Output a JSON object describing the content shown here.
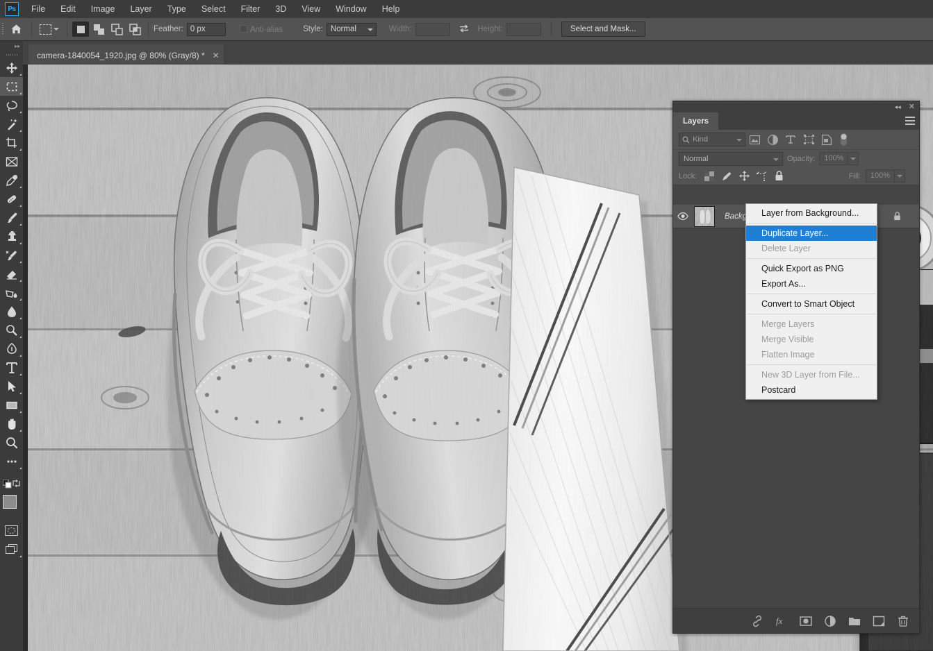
{
  "app": {
    "logo": "Ps",
    "accent": "#31a8ff",
    "menu_highlight": "#1e7fd4"
  },
  "menubar": {
    "items": [
      {
        "label": "File"
      },
      {
        "label": "Edit"
      },
      {
        "label": "Image"
      },
      {
        "label": "Layer"
      },
      {
        "label": "Type"
      },
      {
        "label": "Select"
      },
      {
        "label": "Filter"
      },
      {
        "label": "3D"
      },
      {
        "label": "View"
      },
      {
        "label": "Window"
      },
      {
        "label": "Help"
      }
    ]
  },
  "options_bar": {
    "home_icon": "home-icon",
    "tool_preview_icon": "rectangular-marquee-icon",
    "bool_modes": [
      {
        "name": "new-selection",
        "active": true
      },
      {
        "name": "add-to-selection",
        "active": false
      },
      {
        "name": "subtract-from-selection",
        "active": false
      },
      {
        "name": "intersect-with-selection",
        "active": false
      }
    ],
    "feather_label": "Feather:",
    "feather_value": "0 px",
    "antialias_label": "Anti-alias",
    "antialias_checked": false,
    "style_label": "Style:",
    "style_value": "Normal",
    "width_label": "Width:",
    "width_value": "",
    "swap_icon": "swap-width-height-icon",
    "height_label": "Height:",
    "height_value": "",
    "select_and_mask_label": "Select and Mask..."
  },
  "toolbar": {
    "collapse_icon": "expand-panel-icon",
    "tools": [
      {
        "name": "move-tool",
        "icon": "move-icon",
        "active": false,
        "has_flyout": true
      },
      {
        "name": "rectangular-marquee-tool",
        "icon": "marquee-icon",
        "active": true,
        "has_flyout": true
      },
      {
        "name": "lasso-tool",
        "icon": "lasso-icon",
        "active": false,
        "has_flyout": true
      },
      {
        "name": "object-selection-tool",
        "icon": "magic-wand-icon",
        "active": false,
        "has_flyout": true
      },
      {
        "name": "crop-tool",
        "icon": "crop-icon",
        "active": false,
        "has_flyout": true
      },
      {
        "name": "frame-tool",
        "icon": "frame-icon",
        "active": false,
        "has_flyout": false
      },
      {
        "name": "eyedropper-tool",
        "icon": "eyedropper-icon",
        "active": false,
        "has_flyout": true
      },
      {
        "name": "spot-healing-brush-tool",
        "icon": "healing-brush-icon",
        "active": false,
        "has_flyout": true
      },
      {
        "name": "brush-tool",
        "icon": "brush-icon",
        "active": false,
        "has_flyout": true
      },
      {
        "name": "clone-stamp-tool",
        "icon": "clone-stamp-icon",
        "active": false,
        "has_flyout": true
      },
      {
        "name": "history-brush-tool",
        "icon": "history-brush-icon",
        "active": false,
        "has_flyout": true
      },
      {
        "name": "eraser-tool",
        "icon": "eraser-icon",
        "active": false,
        "has_flyout": true
      },
      {
        "name": "gradient-tool",
        "icon": "paint-bucket-icon",
        "active": false,
        "has_flyout": true
      },
      {
        "name": "blur-tool",
        "icon": "blur-droplet-icon",
        "active": false,
        "has_flyout": true
      },
      {
        "name": "dodge-tool",
        "icon": "dodge-icon",
        "active": false,
        "has_flyout": true
      },
      {
        "name": "pen-tool",
        "icon": "pen-icon",
        "active": false,
        "has_flyout": true
      },
      {
        "name": "type-tool",
        "icon": "type-t-icon",
        "active": false,
        "has_flyout": true
      },
      {
        "name": "path-selection-tool",
        "icon": "path-arrow-icon",
        "active": false,
        "has_flyout": true
      },
      {
        "name": "rectangle-tool",
        "icon": "rectangle-icon",
        "active": false,
        "has_flyout": true
      },
      {
        "name": "hand-tool",
        "icon": "hand-icon",
        "active": false,
        "has_flyout": true
      },
      {
        "name": "zoom-tool",
        "icon": "magnifier-icon",
        "active": false,
        "has_flyout": false
      },
      {
        "name": "edit-toolbar",
        "icon": "ellipsis-icon",
        "active": false,
        "has_flyout": true
      }
    ],
    "default_colors_icon": "default-colors-icon",
    "swap_colors_icon": "swap-colors-icon",
    "foreground_color": "#8c8c8c",
    "background_color": "#ffffff",
    "quick_mask_icon": "quick-mask-icon",
    "screen_mode_icon": "screen-mode-icon"
  },
  "document": {
    "tab_title": "camera-1840054_1920.jpg @ 80% (Gray/8) *",
    "close_icon": "close-icon",
    "zoom": "80%",
    "color_mode": "Gray/8",
    "filename": "camera-1840054_1920.jpg",
    "modified": true
  },
  "layers_panel": {
    "collapse_icon": "collapse-to-icons-icon",
    "close_icon": "close-icon",
    "tab_label": "Layers",
    "menu_icon": "panel-menu-icon",
    "filter": {
      "search_icon": "search-icon",
      "kind_label": "Kind",
      "icons": [
        {
          "name": "filter-pixel-layers-icon"
        },
        {
          "name": "filter-adjustment-layers-icon"
        },
        {
          "name": "filter-type-layers-icon"
        },
        {
          "name": "filter-shape-layers-icon"
        },
        {
          "name": "filter-smart-objects-icon"
        }
      ],
      "toggle_icon": "filter-enable-toggle-icon"
    },
    "blend_mode": "Normal",
    "opacity_label": "Opacity:",
    "opacity_value": "100%",
    "lock_label": "Lock:",
    "lock_icons": [
      {
        "name": "lock-transparent-pixels-icon"
      },
      {
        "name": "lock-image-pixels-icon"
      },
      {
        "name": "lock-position-icon"
      },
      {
        "name": "lock-artboard-nesting-icon"
      },
      {
        "name": "lock-all-icon"
      }
    ],
    "fill_label": "Fill:",
    "fill_value": "100%",
    "layers": [
      {
        "name": "Background",
        "visible": true,
        "locked": true,
        "selected": true,
        "eye_icon": "eye-icon",
        "lock_icon": "lock-icon"
      }
    ],
    "bottom_buttons": [
      {
        "name": "link-layers-button",
        "icon": "link-icon"
      },
      {
        "name": "layer-style-button",
        "icon": "fx-icon"
      },
      {
        "name": "add-layer-mask-button",
        "icon": "mask-icon"
      },
      {
        "name": "new-adjustment-layer-button",
        "icon": "half-circle-icon"
      },
      {
        "name": "new-group-button",
        "icon": "folder-icon"
      },
      {
        "name": "new-layer-button",
        "icon": "new-layer-icon"
      },
      {
        "name": "delete-layer-button",
        "icon": "trash-icon"
      }
    ]
  },
  "context_menu": {
    "items": [
      {
        "label": "Layer from Background...",
        "disabled": false,
        "highlighted": false,
        "separator_after": true
      },
      {
        "label": "Duplicate Layer...",
        "disabled": false,
        "highlighted": true,
        "separator_after": false
      },
      {
        "label": "Delete Layer",
        "disabled": true,
        "highlighted": false,
        "separator_after": true
      },
      {
        "label": "Quick Export as PNG",
        "disabled": false,
        "highlighted": false,
        "separator_after": false
      },
      {
        "label": "Export As...",
        "disabled": false,
        "highlighted": false,
        "separator_after": true
      },
      {
        "label": "Convert to Smart Object",
        "disabled": false,
        "highlighted": false,
        "separator_after": true
      },
      {
        "label": "Merge Layers",
        "disabled": true,
        "highlighted": false,
        "separator_after": false
      },
      {
        "label": "Merge Visible",
        "disabled": true,
        "highlighted": false,
        "separator_after": false
      },
      {
        "label": "Flatten Image",
        "disabled": true,
        "highlighted": false,
        "separator_after": true
      },
      {
        "label": "New 3D Layer from File...",
        "disabled": true,
        "highlighted": false,
        "separator_after": false
      },
      {
        "label": "Postcard",
        "disabled": false,
        "highlighted": false,
        "separator_after": false
      }
    ]
  },
  "canvas": {
    "description": "Grayscale flat-lay photograph: pair of light leather brogue shoes on weathered wooden planks, a striped necktie to the right, a vintage camera and a dark notebook at the far right edge"
  }
}
